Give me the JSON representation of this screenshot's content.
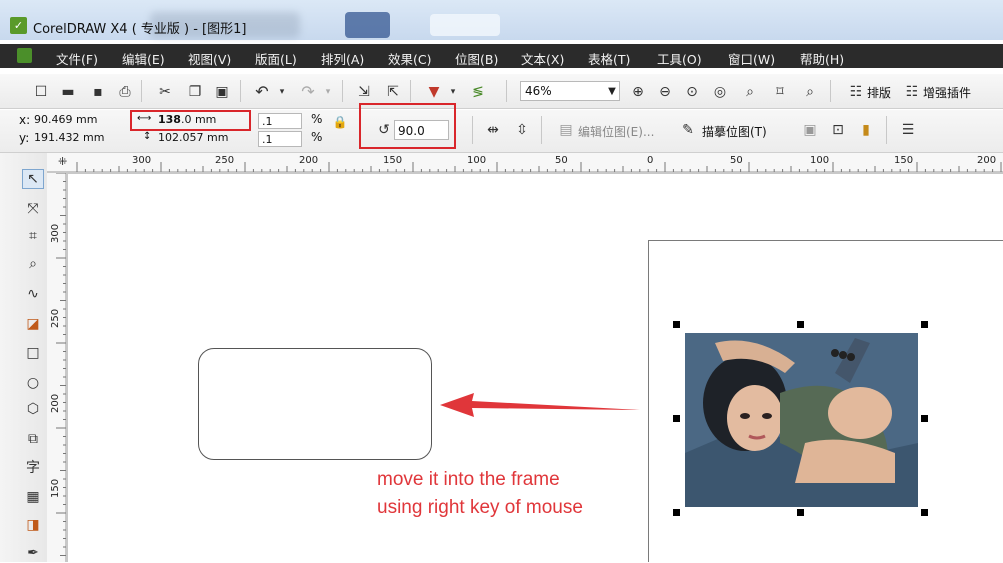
{
  "titlebar": {
    "title": "CorelDRAW X4 ( 专业版 ) - [图形1]"
  },
  "menu": {
    "items": [
      "文件(F)",
      "编辑(E)",
      "视图(V)",
      "版面(L)",
      "排列(A)",
      "效果(C)",
      "位图(B)",
      "文本(X)",
      "表格(T)",
      "工具(O)",
      "窗口(W)",
      "帮助(H)"
    ]
  },
  "toolbar": {
    "zoom": "46%",
    "layout_label": "排版",
    "plugin_label": "增强插件"
  },
  "properties": {
    "x_label": "x:",
    "x_value": "90.469 mm",
    "y_label": "y:",
    "y_value": "191.432 mm",
    "width_value_bold": "138",
    "width_value_rest": ".0 mm",
    "height_value": "102.057 mm",
    "scale_x": ".1",
    "scale_y": ".1",
    "percent_x": "%",
    "percent_y": "%",
    "rotation": "90.0",
    "edit_bitmap": "编辑位图(E)...",
    "trace_bitmap": "描摹位图(T)"
  },
  "ruler": {
    "top_labels": [
      "300",
      "250",
      "200",
      "150",
      "100",
      "50",
      "0",
      "50",
      "100",
      "150",
      "200"
    ],
    "left_labels": [
      "300",
      "250",
      "200",
      "150"
    ]
  },
  "canvas": {
    "annotation_line1": "move it into the frame",
    "annotation_line2": "using right key of mouse",
    "accent_color": "#e0363a"
  },
  "toolbox": {
    "tools": [
      "pick-tool",
      "shape-tool",
      "crop-tool",
      "zoom-tool",
      "freehand-tool",
      "smart-fill-tool",
      "rectangle-tool",
      "ellipse-tool",
      "polygon-tool",
      "basic-shapes-tool",
      "text-tool",
      "table-tool",
      "interactive-blend-tool",
      "eyedropper-tool"
    ],
    "text_tool_glyph": "字"
  }
}
